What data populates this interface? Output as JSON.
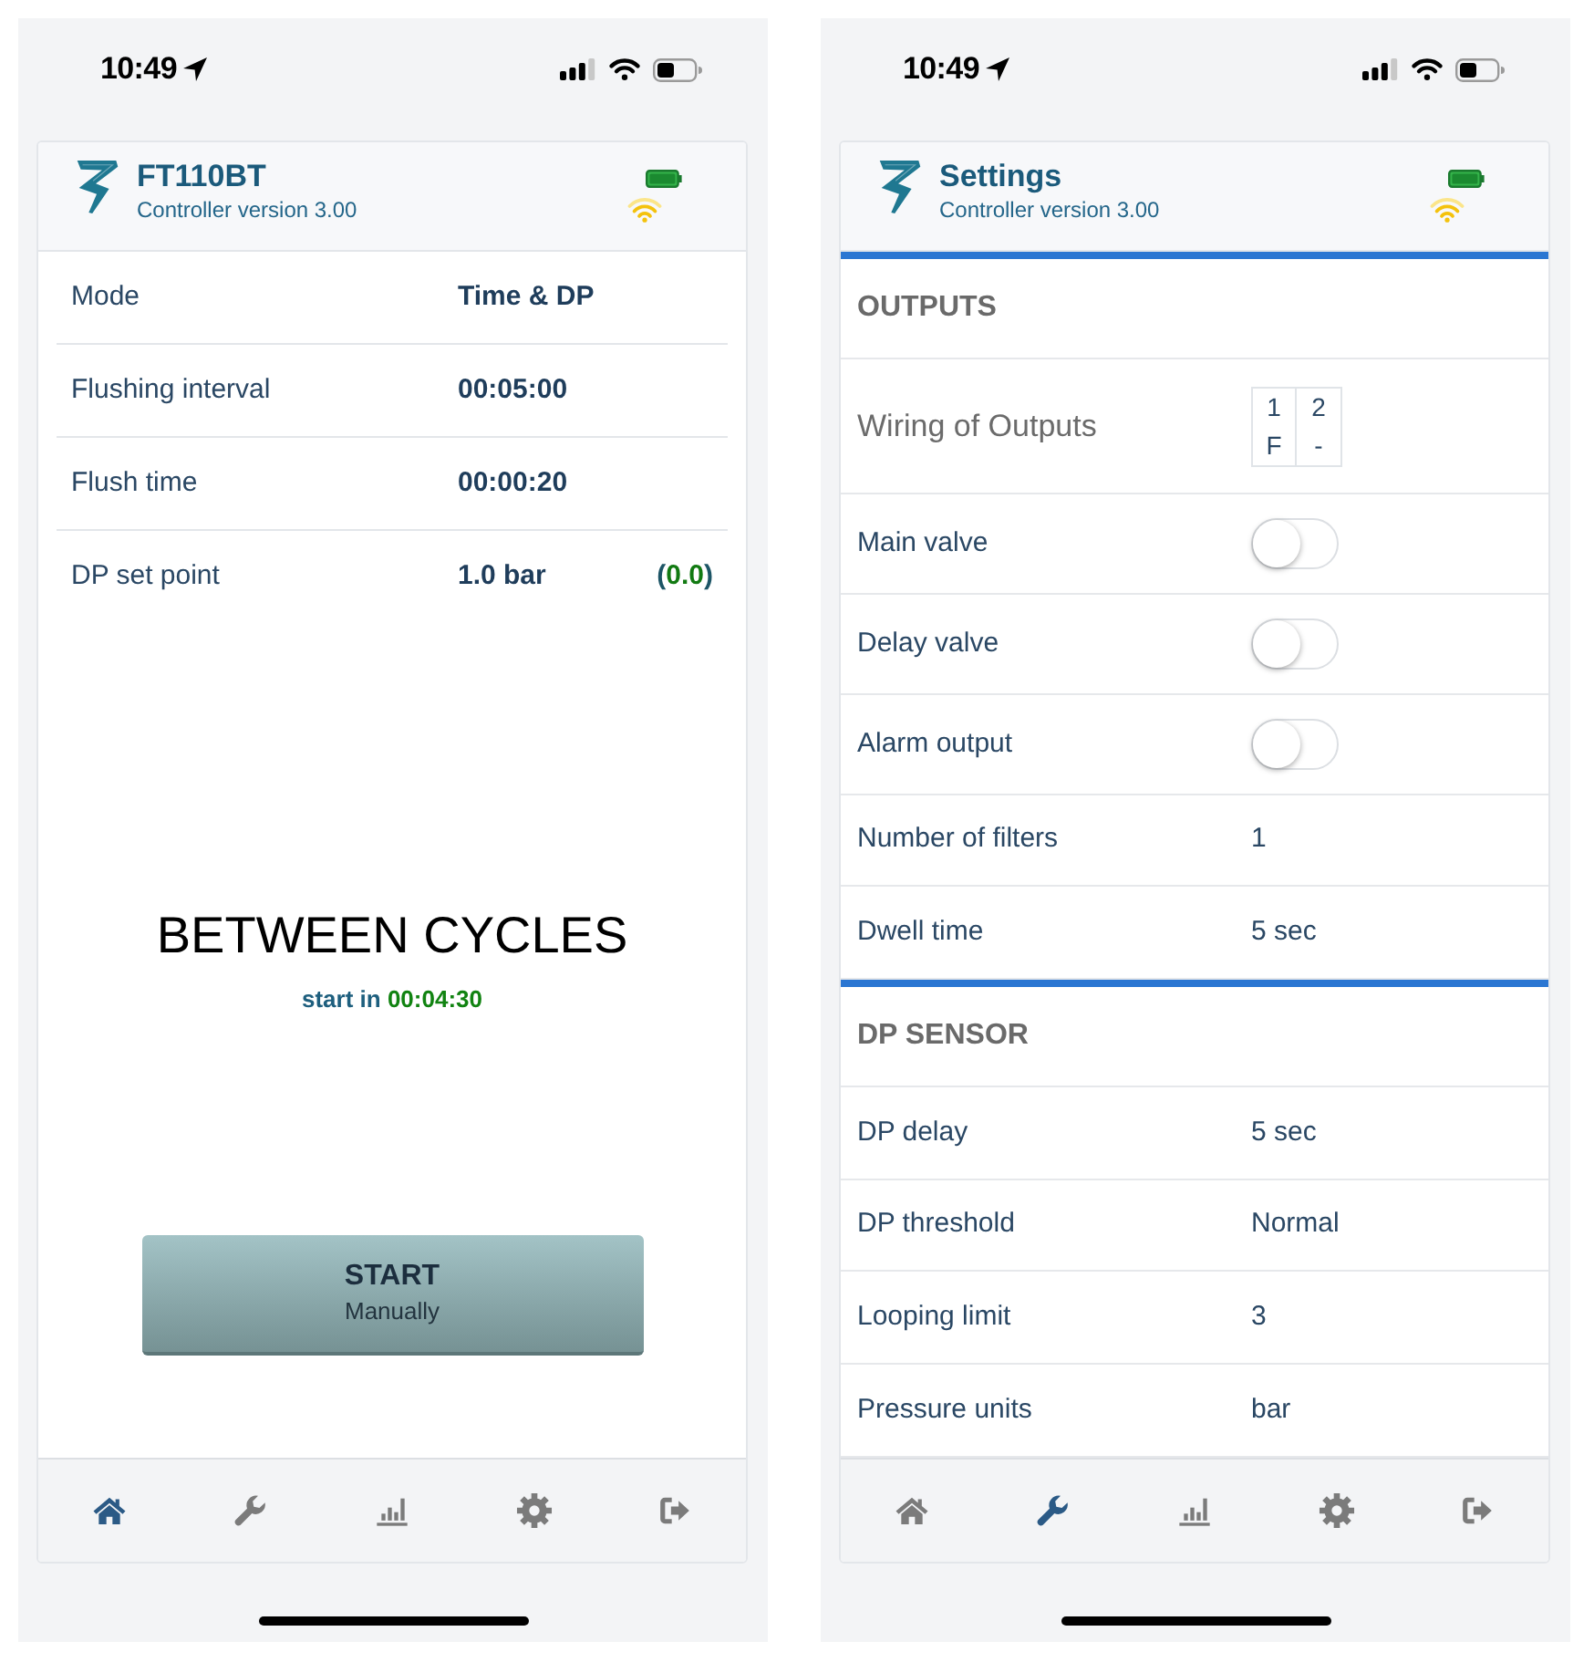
{
  "screens": [
    {
      "kind": "dashboard",
      "status_bar": {
        "time": "10:49"
      },
      "header": {
        "title": "FT110BT",
        "subtitle": "Controller version 3.00"
      },
      "rows": [
        {
          "label": "Mode",
          "value": "Time & DP"
        },
        {
          "label": "Flushing interval",
          "value": "00:05:00"
        },
        {
          "label": "Flush time",
          "value": "00:00:20"
        },
        {
          "label": "DP set point",
          "value": "1.0 bar",
          "reading": "(0.0)"
        }
      ],
      "state": {
        "title": "BETWEEN CYCLES",
        "countdown_label": "start in",
        "countdown_time": "00:04:30"
      },
      "start_button": {
        "label": "START",
        "sublabel": "Manually"
      },
      "nav": [
        {
          "kind": "home",
          "selected": true
        },
        {
          "kind": "wrench",
          "selected": false
        },
        {
          "kind": "chart",
          "selected": false
        },
        {
          "kind": "gear",
          "selected": false
        },
        {
          "kind": "exit",
          "selected": false
        }
      ]
    },
    {
      "kind": "settings",
      "status_bar": {
        "time": "10:49"
      },
      "header": {
        "title": "Settings",
        "subtitle": "Controller version 3.00"
      },
      "sections": [
        {
          "title": "OUTPUTS",
          "rows": [
            {
              "kind": "wiring",
              "label": "Wiring of Outputs",
              "columns": [
                {
                  "output": "1",
                  "function": "F"
                },
                {
                  "output": "2",
                  "function": "-"
                }
              ]
            },
            {
              "kind": "toggle",
              "label": "Main valve",
              "on": false
            },
            {
              "kind": "toggle",
              "label": "Delay valve",
              "on": false
            },
            {
              "kind": "toggle",
              "label": "Alarm output",
              "on": false
            },
            {
              "kind": "value",
              "label": "Number of filters",
              "value": "1"
            },
            {
              "kind": "value",
              "label": "Dwell time",
              "value": "5 sec"
            }
          ]
        },
        {
          "title": "DP SENSOR",
          "rows": [
            {
              "kind": "value",
              "label": "DP delay",
              "value": "5 sec"
            },
            {
              "kind": "value",
              "label": "DP threshold",
              "value": "Normal"
            },
            {
              "kind": "value",
              "label": "Looping limit",
              "value": "3"
            },
            {
              "kind": "value",
              "label": "Pressure units",
              "value": "bar"
            }
          ]
        }
      ],
      "nav": [
        {
          "kind": "home",
          "selected": false
        },
        {
          "kind": "wrench",
          "selected": true
        },
        {
          "kind": "chart",
          "selected": false
        },
        {
          "kind": "gear",
          "selected": false
        },
        {
          "kind": "exit",
          "selected": false
        }
      ]
    }
  ]
}
